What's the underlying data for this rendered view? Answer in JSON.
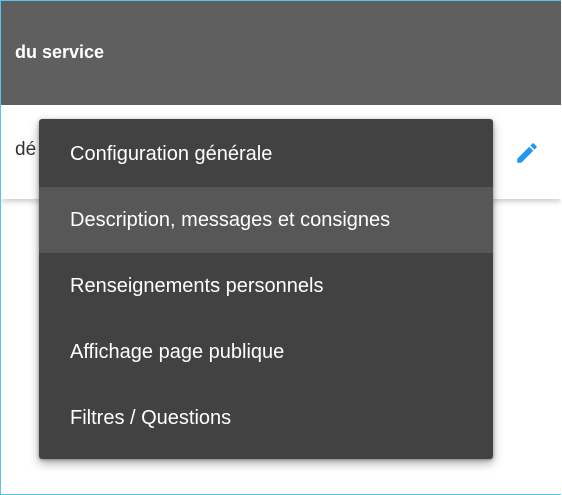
{
  "header": {
    "title": "du service"
  },
  "row": {
    "text": "dé"
  },
  "edit_button": {
    "icon": "pencil-icon",
    "color": "#2196f3"
  },
  "menu": {
    "items": [
      {
        "label": "Configuration générale"
      },
      {
        "label": "Description, messages et consignes"
      },
      {
        "label": "Renseignements personnels"
      },
      {
        "label": "Affichage page publique"
      },
      {
        "label": "Filtres / Questions"
      }
    ],
    "highlighted_index": 1
  }
}
